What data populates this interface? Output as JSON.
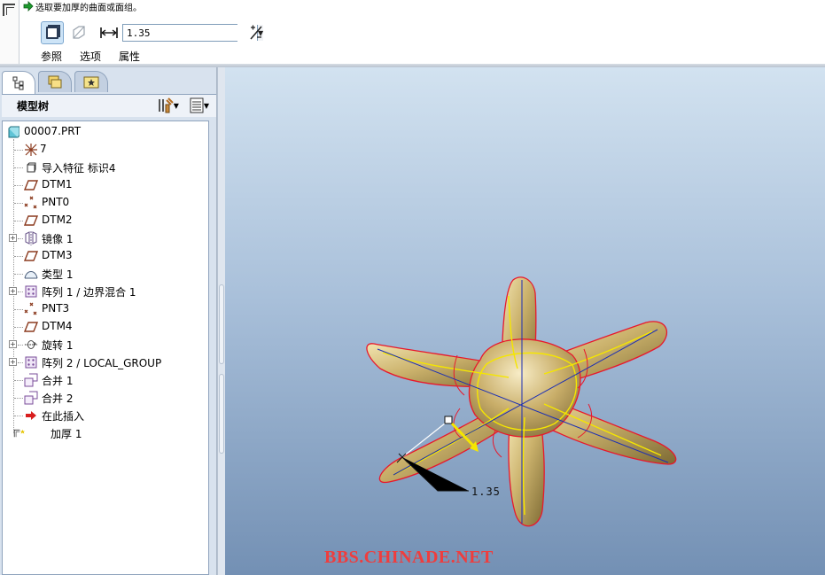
{
  "dashboard": {
    "message": "选取要加厚的曲面或面组。",
    "thickness_value": "1.35",
    "tabs": [
      "参照",
      "选项",
      "属性"
    ]
  },
  "navigator": {
    "tree_title": "模型树"
  },
  "model_tree": {
    "root": "00007.PRT",
    "items": [
      {
        "label": "7",
        "icon": "coord-system-icon",
        "expandable": false
      },
      {
        "label": "导入特征 标识4",
        "icon": "import-feature-icon",
        "expandable": false
      },
      {
        "label": "DTM1",
        "icon": "datum-plane-icon",
        "expandable": false
      },
      {
        "label": "PNT0",
        "icon": "datum-point-icon",
        "expandable": false
      },
      {
        "label": "DTM2",
        "icon": "datum-plane-icon",
        "expandable": false
      },
      {
        "label": "镜像 1",
        "icon": "mirror-icon",
        "expandable": true
      },
      {
        "label": "DTM3",
        "icon": "datum-plane-icon",
        "expandable": false
      },
      {
        "label": "类型 1",
        "icon": "surface-icon",
        "expandable": false
      },
      {
        "label": "阵列 1 / 边界混合 1",
        "icon": "pattern-icon",
        "expandable": true
      },
      {
        "label": "PNT3",
        "icon": "datum-point-icon",
        "expandable": false
      },
      {
        "label": "DTM4",
        "icon": "datum-plane-icon",
        "expandable": false
      },
      {
        "label": "旋转 1",
        "icon": "revolve-icon",
        "expandable": true
      },
      {
        "label": "阵列 2 / LOCAL_GROUP",
        "icon": "pattern-icon",
        "expandable": true
      },
      {
        "label": "合并 1",
        "icon": "merge-icon",
        "expandable": false
      },
      {
        "label": "合并 2",
        "icon": "merge-icon",
        "expandable": false
      },
      {
        "label": "在此插入",
        "icon": "insert-here-icon",
        "expandable": false
      },
      {
        "label": "加厚 1",
        "icon": "thicken-icon",
        "expandable": false
      }
    ]
  },
  "graphics": {
    "dimension_label": "1.35",
    "watermark": "BBS.CHINADE.NET"
  },
  "colors": {
    "edge": "#e8182c",
    "highlight": "#f5e600",
    "surface": "#c7b06b",
    "watermark": "#ef3d3d"
  }
}
